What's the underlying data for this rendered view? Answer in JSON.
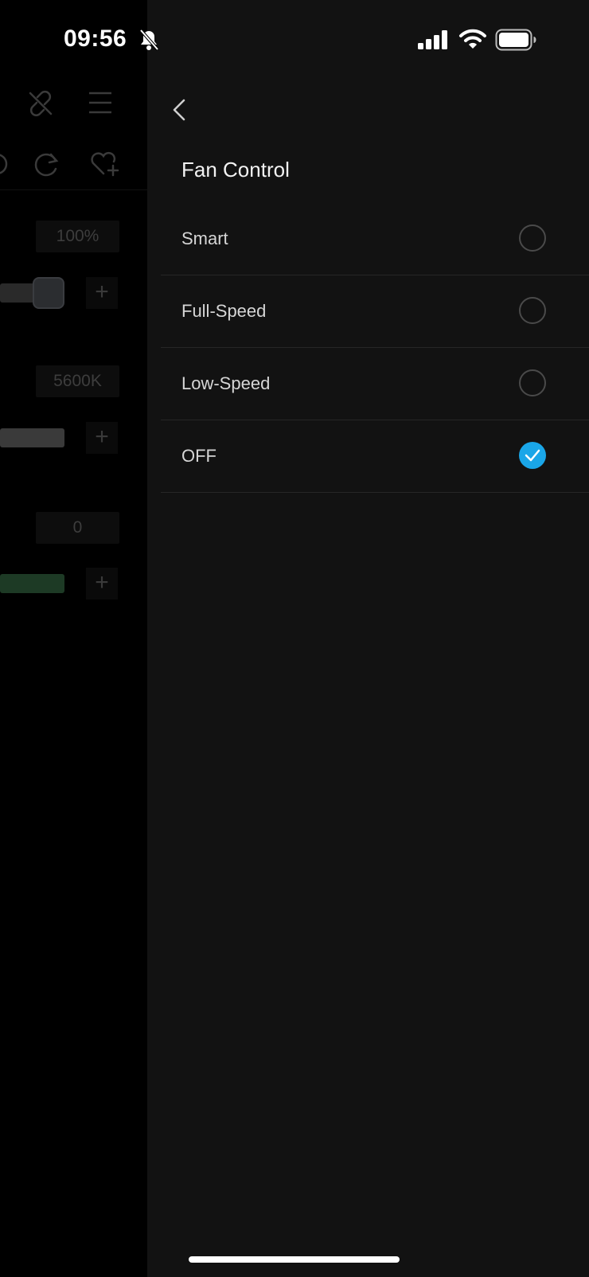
{
  "status_bar": {
    "time": "09:56",
    "icons": [
      "bell-slash-icon",
      "cellular-signal-icon",
      "wifi-icon",
      "battery-icon"
    ]
  },
  "background_app": {
    "toolbar_icons": [
      "link-off-icon",
      "menu-icon",
      "redo-icon",
      "heart-plus-icon"
    ],
    "brightness_value": "100%",
    "cct_value": "5600K",
    "gm_value": "0",
    "plus_label": "+"
  },
  "drawer": {
    "title": "Fan Control",
    "options": [
      {
        "label": "Smart",
        "selected": false
      },
      {
        "label": "Full-Speed",
        "selected": false
      },
      {
        "label": "Low-Speed",
        "selected": false
      },
      {
        "label": "OFF",
        "selected": true
      }
    ],
    "accent_color": "#1aa6e8"
  }
}
